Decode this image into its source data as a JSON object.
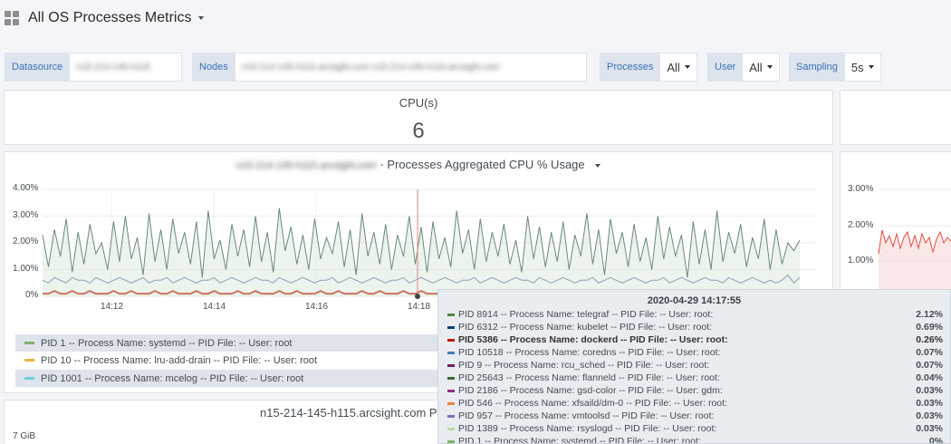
{
  "header": {
    "title": "All OS Processes Metrics"
  },
  "variables": {
    "datasource": {
      "label": "Datasource",
      "value": "n15-214-145-h115"
    },
    "nodes": {
      "label": "Nodes",
      "value": "n15-214-145-h115.arcsight.com n15-214-145-h116.arcsight.com"
    },
    "processes": {
      "label": "Processes",
      "value": "All"
    },
    "user": {
      "label": "User",
      "value": "All"
    },
    "sampling": {
      "label": "Sampling",
      "value": "5s"
    }
  },
  "cpu_panel": {
    "title": "CPU(s)",
    "value": "6"
  },
  "cpu_usage_panel": {
    "title_host": "n15-214-145-h115.arcsight.com",
    "title_suffix": "· Processes Aggregated CPU % Usage",
    "legend": [
      {
        "label": "PID 1 -- Process Name: systemd -- PID File: -- User: root",
        "color": "#7eb26d"
      },
      {
        "label": "PID 10 -- Process Name: lru-add-drain -- PID File: -- User: root",
        "color": "#eab839"
      },
      {
        "label": "PID 1001 -- Process Name: mcelog -- PID File: -- User: root",
        "color": "#6ed0e0"
      }
    ]
  },
  "right_panel": {
    "y_ticks": [
      "3.00%",
      "2.00%",
      "1.00%"
    ]
  },
  "memory_panel": {
    "title": "n15-214-145-h115.arcsight.com Pr",
    "y_tick": "7 GiB"
  },
  "chart_data": {
    "type": "line",
    "xlabel": "",
    "ylabel": "",
    "y_ticks": [
      "4.00%",
      "3.00%",
      "2.00%",
      "1.00%",
      "0%"
    ],
    "x_ticks": [
      "14:12",
      "14:14",
      "14:16",
      "14:18"
    ],
    "ylim": [
      0,
      4
    ],
    "xlim": [
      "14:10:45",
      "14:25:00"
    ],
    "grid": true,
    "hover_time": "14:17:55",
    "series": [
      {
        "name": "PID 8914 -- Process Name: telegraf -- PID File: -- User: root",
        "color": "#508642",
        "values": [
          2.3,
          1.1,
          2.5,
          1.5,
          2.9,
          0.9,
          2.4,
          1.2,
          2.7,
          1.6,
          2.0,
          1.0,
          2.8,
          1.3,
          3.0,
          1.4,
          2.2,
          0.8,
          3.1,
          1.3,
          2.5,
          1.0,
          2.9,
          1.6,
          2.4,
          1.2,
          2.8,
          0.7,
          3.2,
          1.4,
          2.1,
          1.0,
          2.7,
          1.5,
          2.5,
          1.1,
          3.0,
          1.3,
          2.4,
          0.9,
          3.3,
          1.7,
          2.6,
          1.2,
          2.3,
          1.0,
          2.9,
          1.4,
          2.2,
          1.6,
          2.8,
          1.1,
          2.5,
          0.8,
          3.1,
          1.5,
          2.4,
          1.2,
          2.7,
          1.0,
          2.3,
          1.5,
          3.0,
          1.2,
          2.6,
          0.9,
          2.8,
          1.4,
          2.2,
          1.1,
          3.2,
          1.6,
          2.5,
          1.0,
          2.9,
          1.3,
          2.4,
          1.5,
          2.7,
          1.2,
          2.1,
          0.9,
          3.0,
          1.4,
          2.6,
          1.1,
          2.4,
          1.3,
          2.8,
          1.0,
          2.3,
          1.5,
          3.1,
          1.2,
          2.5,
          0.8,
          2.9,
          1.6,
          2.4,
          1.1,
          2.7,
          1.3,
          2.2,
          1.0,
          3.0,
          1.4,
          2.6,
          1.5,
          2.3,
          0.7,
          2.8,
          1.2,
          2.5,
          1.0,
          3.2,
          1.3,
          2.4,
          1.6,
          2.7,
          1.1,
          2.2,
          1.4,
          2.9,
          1.0,
          2.5,
          1.2,
          2.0,
          1.7,
          2.1
        ]
      },
      {
        "name": "PID 6312 -- Process Name: kubelet -- PID File: -- User: root",
        "color": "#0a437c",
        "values": [
          0.6,
          0.5,
          0.7,
          0.6,
          0.5,
          0.7,
          0.6,
          0.6,
          0.5,
          0.7,
          0.6,
          0.5,
          0.6,
          0.7,
          0.6,
          0.5,
          0.6,
          0.7,
          0.5,
          0.6,
          0.6,
          0.7,
          0.5,
          0.6,
          0.7,
          0.6,
          0.5,
          0.6,
          0.6,
          0.7,
          0.5,
          0.6,
          0.7,
          0.6,
          0.5,
          0.6,
          0.7,
          0.6,
          0.6,
          0.5,
          0.7,
          0.6,
          0.5,
          0.6,
          0.7,
          0.6,
          0.5,
          0.6,
          0.6,
          0.7,
          0.5,
          0.6,
          0.7,
          0.6,
          0.5,
          0.6,
          0.7,
          0.6,
          0.5,
          0.6,
          0.6,
          0.7,
          0.5,
          0.6,
          0.7,
          0.6,
          0.5,
          0.6,
          0.7,
          0.6,
          0.5,
          0.6,
          0.6,
          0.7,
          0.5,
          0.6,
          0.7,
          0.6,
          0.5,
          0.6,
          0.7,
          0.6,
          0.6,
          0.5,
          0.7,
          0.6,
          0.5,
          0.6,
          0.7,
          0.6,
          0.5,
          0.6,
          0.6,
          0.7,
          0.5,
          0.6,
          0.7,
          0.6,
          0.5,
          0.6,
          0.7,
          0.6,
          0.5,
          0.6,
          0.6,
          0.7,
          0.5,
          0.6,
          0.7,
          0.6,
          0.5,
          0.6,
          0.7,
          0.6,
          0.6,
          0.5,
          0.7,
          0.6,
          0.5,
          0.6,
          0.7,
          0.6,
          0.5,
          0.6,
          0.5,
          0.6,
          0.8,
          0.5,
          0.7
        ]
      },
      {
        "name": "PID 5386 -- Process Name: dockerd -- PID File: -- User: root",
        "color": "#bf1b00",
        "values": [
          0.1,
          0.1,
          0.2,
          0.1,
          0.1,
          0.2,
          0.1,
          0.1,
          0.2,
          0.1,
          0.1,
          0.1,
          0.2,
          0.1,
          0.1,
          0.2,
          0.1,
          0.1,
          0.1,
          0.2,
          0.1,
          0.1,
          0.2,
          0.1,
          0.1,
          0.1,
          0.2,
          0.1,
          0.1,
          0.2,
          0.1,
          0.1,
          0.1,
          0.2,
          0.1,
          0.1,
          0.2,
          0.1,
          0.1,
          0.1,
          0.2,
          0.1,
          0.1,
          0.2,
          0.1,
          0.1,
          0.1,
          0.2,
          0.1,
          0.1,
          0.2,
          0.1,
          0.1,
          0.1,
          0.2,
          0.1,
          0.1,
          0.2,
          0.1,
          0.1,
          0.1,
          0.2,
          0.1,
          0.1,
          0.2,
          0.1,
          0.1,
          0.1,
          0.2,
          0.1,
          0.1,
          0.2,
          0.1,
          0.1,
          0.1,
          0.2,
          0.1,
          0.1,
          0.2,
          0.1,
          0.1,
          0.1,
          0.2,
          0.1,
          0.1,
          0.2,
          0.1,
          0.1,
          0.1,
          0.2,
          0.1,
          0.1,
          0.2,
          0.1,
          0.1,
          0.1,
          0.2,
          0.1,
          0.1,
          0.2,
          0.1,
          0.1,
          0.1,
          0.2,
          0.1,
          0.1,
          0.2,
          0.1,
          0.1,
          0.1,
          0.2,
          0.1,
          0.1,
          0.2,
          0.1,
          0.1,
          0.1,
          0.2,
          0.1,
          0.1,
          0.2,
          0.1,
          0.1,
          0.1,
          0.2,
          0.1,
          0.1,
          0.2,
          0.1
        ]
      }
    ]
  },
  "tooltip": {
    "time": "2020-04-29 14:17:55",
    "rows": [
      {
        "label": "PID 8914 -- Process Name: telegraf -- PID File: -- User: root:",
        "value": "2.12%",
        "color": "#508642",
        "bold": false
      },
      {
        "label": "PID 6312 -- Process Name: kubelet -- PID File: -- User: root:",
        "value": "0.69%",
        "color": "#0a437c",
        "bold": false
      },
      {
        "label": "PID 5386 -- Process Name: dockerd -- PID File: -- User: root:",
        "value": "0.26%",
        "color": "#bf1b00",
        "bold": true
      },
      {
        "label": "PID 10518 -- Process Name: coredns -- PID File: -- User: root:",
        "value": "0.07%",
        "color": "#447ebc",
        "bold": false
      },
      {
        "label": "PID 9 -- Process Name: rcu_sched -- PID File: -- User: root:",
        "value": "0.07%",
        "color": "#6d1f62",
        "bold": false
      },
      {
        "label": "PID 25643 -- Process Name: flanneld -- PID File: -- User: root:",
        "value": "0.04%",
        "color": "#3f6833",
        "bold": false
      },
      {
        "label": "PID 2186 -- Process Name: gsd-color -- PID File: -- User: gdm:",
        "value": "0.03%",
        "color": "#962d82",
        "bold": false
      },
      {
        "label": "PID 546 -- Process Name: xfsaild/dm-0 -- PID File: -- User: root:",
        "value": "0.03%",
        "color": "#ef843c",
        "bold": false
      },
      {
        "label": "PID 957 -- Process Name: vmtoolsd -- PID File: -- User: root:",
        "value": "0.03%",
        "color": "#806eb7",
        "bold": false
      },
      {
        "label": "PID 1389 -- Process Name: rsyslogd -- PID File: -- User: root:",
        "value": "0.03%",
        "color": "#b7dbab",
        "bold": false
      },
      {
        "label": "PID 1 -- Process Name: systemd -- PID File: -- User: root:",
        "value": "0%",
        "color": "#7eb26d",
        "bold": false
      }
    ]
  }
}
